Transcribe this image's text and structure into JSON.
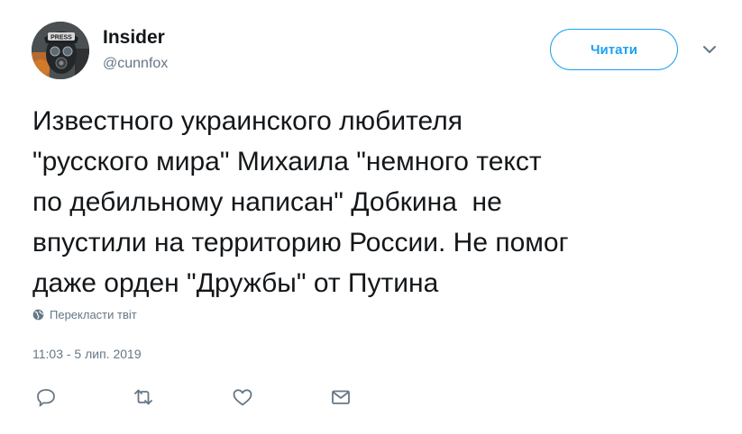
{
  "user": {
    "display_name": "Insider",
    "handle": "@cunnfox",
    "avatar_press_text": "PRESS"
  },
  "follow_button": {
    "label": "Читати"
  },
  "tweet": {
    "text": "Известного украинского любителя\n\"русского мира\" Михаила \"немного текст\nпо дебильному написан\" Добкина  не\nвпустили на территорию России. Не помог\nдаже орден \"Дружбы\" от Путина",
    "translate_label": "Перекласти твіт",
    "timestamp": "11:03 - 5 лип. 2019"
  },
  "actions": [
    {
      "icon": "reply-icon"
    },
    {
      "icon": "retweet-icon"
    },
    {
      "icon": "like-icon"
    },
    {
      "icon": "message-icon"
    }
  ],
  "colors": {
    "accent": "#1da1f2",
    "text": "#14171a",
    "muted": "#657786"
  }
}
